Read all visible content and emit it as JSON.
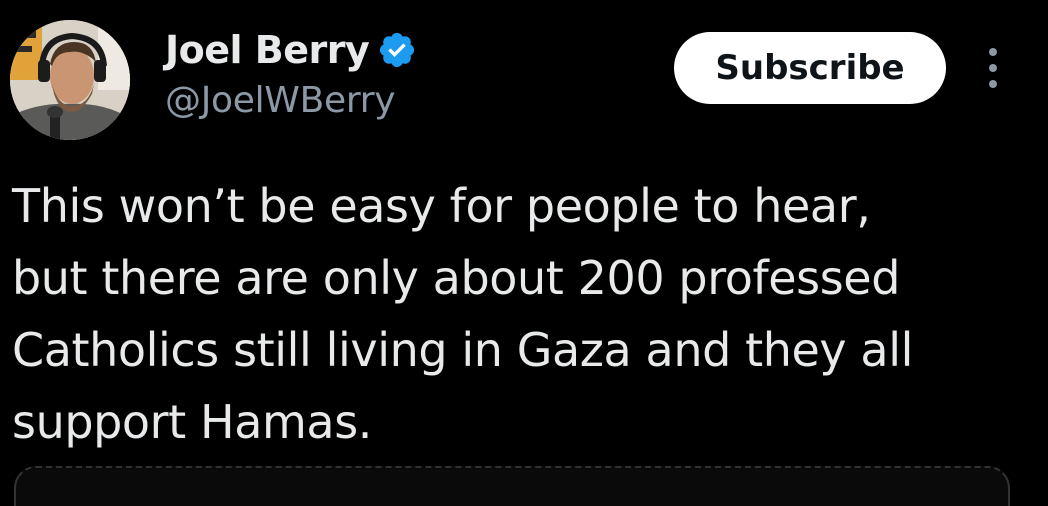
{
  "tweet": {
    "author": {
      "display_name": "Joel Berry",
      "handle": "@JoelWBerry",
      "verified": true,
      "verified_color": "#1d9bf0",
      "avatar_icon": "avatar-photo"
    },
    "subscribe_label": "Subscribe",
    "more_icon": "more-vertical-icon",
    "text": "This won’t be easy for people to hear,\nbut there are only about 200 professed\nCatholics still living in Gaza and they all\nsupport Hamas."
  },
  "colors": {
    "background": "#000000",
    "primary_text": "#e7e9ea",
    "secondary_text": "#8b98a5",
    "button_bg": "#ffffff",
    "button_text": "#0f1419",
    "accent": "#1d9bf0"
  }
}
